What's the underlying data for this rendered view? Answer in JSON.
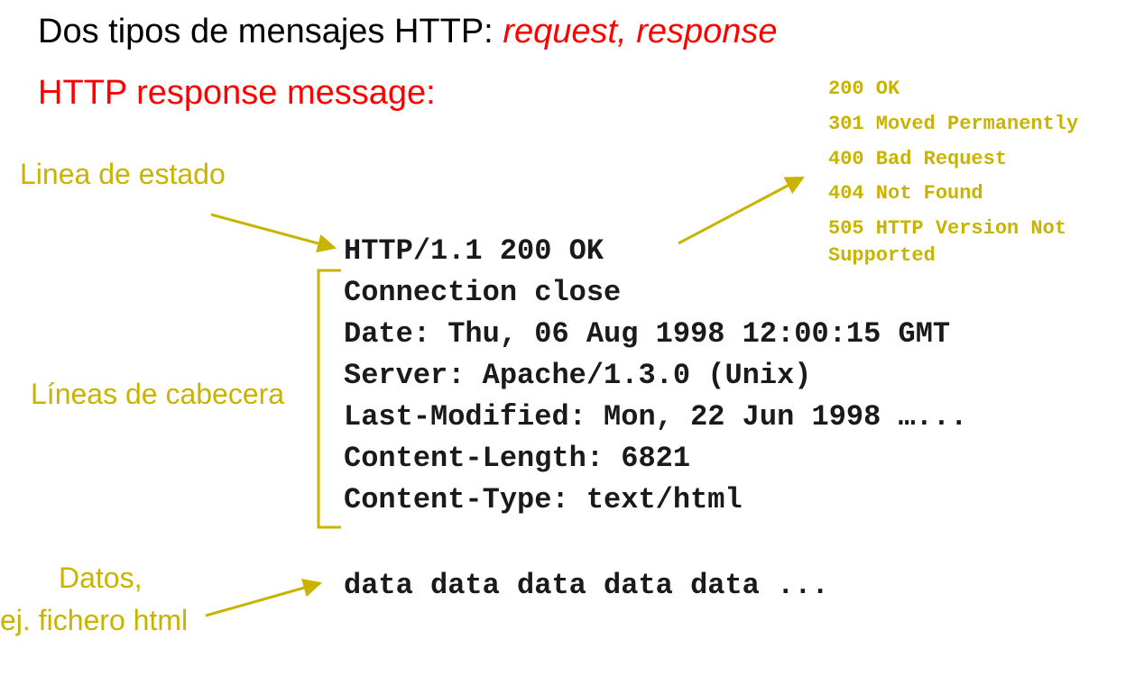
{
  "title": {
    "prefix": "Dos tipos de mensajes HTTP: ",
    "request": "request",
    "sep": ", ",
    "response": "response"
  },
  "subtitle": "HTTP response message:",
  "status_codes": [
    "200 OK",
    "301 Moved Permanently",
    "400 Bad Request",
    "404 Not Found",
    "505 HTTP Version Not"
  ],
  "status_codes_continuation": "Supported",
  "annotations": {
    "status_line": "Linea de estado",
    "header_lines": "Líneas de cabecera",
    "data_line1": "Datos,",
    "data_line2": "ej. fichero html"
  },
  "message": {
    "status_line": "HTTP/1.1 200 OK",
    "headers": [
      "Connection close",
      "Date: Thu, 06 Aug 1998 12:00:15 GMT",
      "Server: Apache/1.3.0 (Unix)",
      "Last-Modified: Mon, 22 Jun 1998 …...",
      "Content-Length: 6821",
      "Content-Type: text/html"
    ],
    "body": "data data data data data ..."
  },
  "colors": {
    "annotation": "#c8b400",
    "accent": "#ff0000",
    "text": "#000000"
  }
}
